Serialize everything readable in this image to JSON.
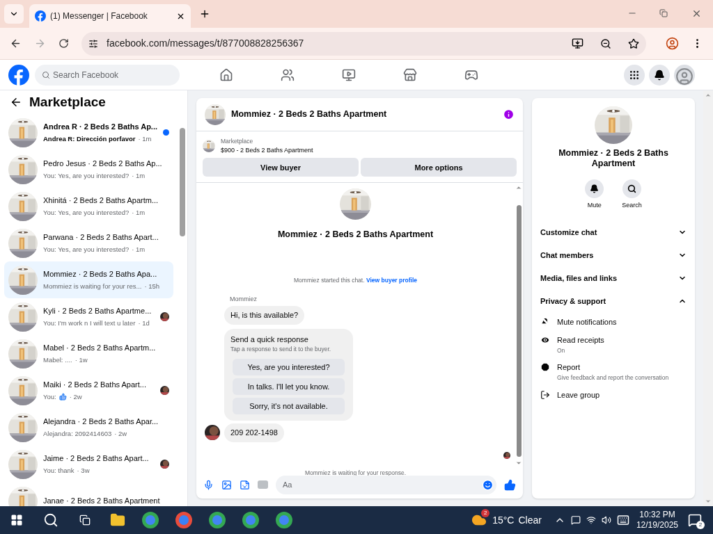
{
  "browser": {
    "tab_title": "(1) Messenger | Facebook",
    "url": "facebook.com/messages/t/877008828256367"
  },
  "facebook": {
    "search_placeholder": "Search Facebook"
  },
  "sidebar": {
    "title": "Marketplace",
    "conversations": [
      {
        "title": "Andrea R · 2 Beds 2 Baths Ap...",
        "snippet": "Andrea R: Dirección porfavor",
        "time": "· 1m",
        "unread": true,
        "selected": false,
        "seen_avatar": false,
        "like_icon": false
      },
      {
        "title": "Pedro Jesus · 2 Beds 2 Baths Ap...",
        "snippet": "You: Yes, are you interested?",
        "time": "· 1m",
        "unread": false,
        "selected": false,
        "seen_avatar": false,
        "like_icon": false
      },
      {
        "title": "Xhinitá · 2 Beds 2 Baths Apartm...",
        "snippet": "You: Yes, are you interested?",
        "time": "· 1m",
        "unread": false,
        "selected": false,
        "seen_avatar": false,
        "like_icon": false
      },
      {
        "title": "Parwana · 2 Beds 2 Baths Apart...",
        "snippet": "You: Yes, are you interested?",
        "time": "· 1m",
        "unread": false,
        "selected": false,
        "seen_avatar": false,
        "like_icon": false
      },
      {
        "title": "Mommiez · 2 Beds 2 Baths Apa...",
        "snippet": "Mommiez is waiting for your res...",
        "time": "· 15h",
        "unread": false,
        "selected": true,
        "seen_avatar": false,
        "like_icon": false
      },
      {
        "title": "Kyli · 2 Beds 2 Baths Apartme...",
        "snippet": "You: I'm work n I will text u later",
        "time": "· 1d",
        "unread": false,
        "selected": false,
        "seen_avatar": true,
        "like_icon": false
      },
      {
        "title": "Mabel · 2 Beds 2 Baths Apartm...",
        "snippet": "Mabel: ....",
        "time": "· 1w",
        "unread": false,
        "selected": false,
        "seen_avatar": false,
        "like_icon": false
      },
      {
        "title": "Maiki · 2 Beds 2 Baths Apart...",
        "snippet": "You:",
        "time": "· 2w",
        "unread": false,
        "selected": false,
        "seen_avatar": true,
        "like_icon": true
      },
      {
        "title": "Alejandra · 2 Beds 2 Baths Apar...",
        "snippet": "Alejandra: 2092414603",
        "time": "· 2w",
        "unread": false,
        "selected": false,
        "seen_avatar": false,
        "like_icon": false
      },
      {
        "title": "Jaime · 2 Beds 2 Baths Apart...",
        "snippet": "You: thank",
        "time": "· 3w",
        "unread": false,
        "selected": false,
        "seen_avatar": true,
        "like_icon": false
      },
      {
        "title": "Janae · 2 Beds 2 Baths Apartment",
        "unread": false,
        "selected": false,
        "seen_avatar": false,
        "like_icon": false
      }
    ]
  },
  "chat": {
    "header_title": "Mommiez · 2 Beds 2 Baths Apartment",
    "listing": {
      "label": "Marketplace",
      "title": "$900 - 2 Beds 2 Baths Apartment"
    },
    "actions": [
      "View buyer",
      "More options"
    ],
    "intro_title": "Mommiez · 2 Beds 2 Baths Apartment",
    "started_text": "Mommiez started this chat.",
    "started_link": "View buyer profile",
    "messages": [
      {
        "kind": "text",
        "sender": "Mommiez",
        "text": "Hi, is this available?",
        "avatar": false
      },
      {
        "kind": "quick_response",
        "title": "Send a quick response",
        "subtitle": "Tap a response to send it to the buyer.",
        "options": [
          "Yes, are you interested?",
          "In talks. I'll let you know.",
          "Sorry, it's not available."
        ]
      },
      {
        "kind": "text",
        "text": "209 202-1498",
        "avatar": true
      }
    ],
    "status": "Mommiez is waiting for your response.",
    "composer_placeholder": "Aa"
  },
  "details": {
    "title": "Mommiez · 2 Beds 2 Baths Apartment",
    "actions": [
      {
        "label": "Mute"
      },
      {
        "label": "Search"
      }
    ],
    "sections": [
      {
        "label": "Customize chat",
        "expanded": false
      },
      {
        "label": "Chat members",
        "expanded": false
      },
      {
        "label": "Media, files and links",
        "expanded": false
      },
      {
        "label": "Privacy & support",
        "expanded": true,
        "items": [
          {
            "label": "Mute notifications"
          },
          {
            "label": "Read receipts",
            "detail": "On"
          },
          {
            "label": "Report",
            "detail": "Give feedback and report the conversation"
          },
          {
            "label": "Leave group"
          }
        ]
      }
    ]
  },
  "taskbar": {
    "weather_badge": "2",
    "temperature": "15°C",
    "condition": "Clear",
    "time": "10:32 PM",
    "date": "12/19/2025",
    "notification_count": "2"
  }
}
